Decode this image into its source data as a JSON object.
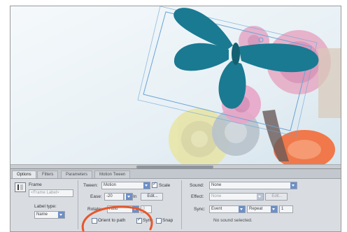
{
  "panel": {
    "tabs": [
      "Options",
      "Filters",
      "Parameters",
      "Motion Tween"
    ],
    "instance_label": "Frame",
    "instance_field": "<Frame Label>",
    "label_type_label": "Label type:",
    "label_type_value": "Name",
    "tween": {
      "label": "Tween:",
      "value": "Motion"
    },
    "scale_label": "Scale",
    "ease": {
      "label": "Ease:",
      "value": "-20"
    },
    "ease_unit": "In",
    "edit_button": "Edit...",
    "rotate": {
      "label": "Rotate:",
      "value": "Auto"
    },
    "rotate_times": "0",
    "orient_label": "Orient to path",
    "sync_label": "Sync",
    "snap_label": "Snap",
    "sound": {
      "label": "Sound:",
      "value": "None"
    },
    "effect": {
      "label": "Effect:",
      "value": "None"
    },
    "sync_select": {
      "label": "Sync:",
      "value": "Event"
    },
    "repeat": {
      "value": "Repeat",
      "count": "1"
    },
    "no_sound": "No sound selected."
  },
  "colors": {
    "butterfly": "#1a7a92",
    "bbox": "#6aa3d6",
    "highlight": "#e8572a"
  }
}
